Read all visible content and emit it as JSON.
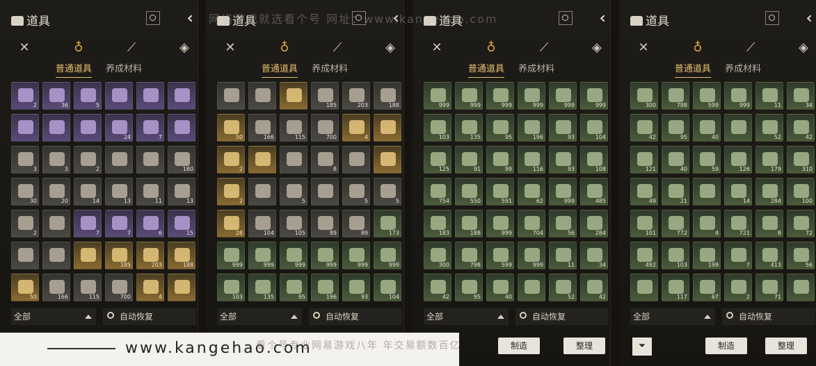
{
  "panel_title": "道具",
  "sub_tabs": [
    "普通道具",
    "养成材料"
  ],
  "filter_label": "全部",
  "auto_restore": "自动恢复",
  "craft_button": "制造",
  "sort_button": "整理",
  "banner_url": "www.kangehao.com",
  "watermark_top": "网络游戏就选看个号  网址：www.kangehao.com",
  "watermark_bottom": "看个号专业网易游戏八年  年交易额数百亿",
  "icons": {
    "category_1": "crossed-swords-icon",
    "category_2": "pouch-icon",
    "category_3": "scroll-icon",
    "category_4": "gem-icon"
  },
  "colors": {
    "accent": "#e8c070",
    "panel": "#1e1c18"
  },
  "panels": [
    {
      "rows": [
        [
          {
            "r": "purple",
            "c": "2"
          },
          {
            "r": "purple",
            "c": "36"
          },
          {
            "r": "purple",
            "c": "5"
          },
          {
            "r": "purple",
            "c": ""
          },
          {
            "r": "purple",
            "c": ""
          },
          {
            "r": "purple",
            "c": ""
          }
        ],
        [
          {
            "r": "purple",
            "c": ""
          },
          {
            "r": "purple",
            "c": ""
          },
          {
            "r": "purple",
            "c": ""
          },
          {
            "r": "purple",
            "c": "24"
          },
          {
            "r": "purple",
            "c": "7"
          },
          {
            "r": "purple",
            "c": ""
          }
        ],
        [
          {
            "r": "gray",
            "c": "3"
          },
          {
            "r": "gray",
            "c": "3"
          },
          {
            "r": "gray",
            "c": "2"
          },
          {
            "r": "gray",
            "c": ""
          },
          {
            "r": "gray",
            "c": ""
          },
          {
            "r": "gray",
            "c": "180"
          }
        ],
        [
          {
            "r": "gray",
            "c": "30"
          },
          {
            "r": "gray",
            "c": "20"
          },
          {
            "r": "gray",
            "c": "14"
          },
          {
            "r": "gray",
            "c": "13"
          },
          {
            "r": "gray",
            "c": "11"
          },
          {
            "r": "gray",
            "c": "13"
          }
        ],
        [
          {
            "r": "gray",
            "c": "2"
          },
          {
            "r": "gray",
            "c": ""
          },
          {
            "r": "purple",
            "c": "7"
          },
          {
            "r": "purple",
            "c": "7"
          },
          {
            "r": "purple",
            "c": "6"
          },
          {
            "r": "purple",
            "c": "15"
          }
        ],
        [
          {
            "r": "gray",
            "c": ""
          },
          {
            "r": "gray",
            "c": ""
          },
          {
            "r": "gold",
            "c": ""
          },
          {
            "r": "gold",
            "c": "185"
          },
          {
            "r": "gold",
            "c": "203"
          },
          {
            "r": "gold",
            "c": "188"
          }
        ],
        [
          {
            "r": "gold",
            "c": "50"
          },
          {
            "r": "gray",
            "c": "166"
          },
          {
            "r": "gray",
            "c": "115"
          },
          {
            "r": "gray",
            "c": "700"
          },
          {
            "r": "gold",
            "c": "4"
          },
          {
            "r": "gold",
            "c": ""
          }
        ]
      ]
    },
    {
      "rows": [
        [
          {
            "r": "gray",
            "c": ""
          },
          {
            "r": "gray",
            "c": ""
          },
          {
            "r": "gold",
            "c": ""
          },
          {
            "r": "gray",
            "c": "185"
          },
          {
            "r": "gray",
            "c": "203"
          },
          {
            "r": "gray",
            "c": "188"
          }
        ],
        [
          {
            "r": "gold",
            "c": "50"
          },
          {
            "r": "gray",
            "c": "166"
          },
          {
            "r": "gray",
            "c": "115"
          },
          {
            "r": "gray",
            "c": "700"
          },
          {
            "r": "gold",
            "c": "4"
          },
          {
            "r": "gold",
            "c": ""
          }
        ],
        [
          {
            "r": "gold",
            "c": "2"
          },
          {
            "r": "gold",
            "c": ""
          },
          {
            "r": "gray",
            "c": ""
          },
          {
            "r": "gray",
            "c": "8"
          },
          {
            "r": "gray",
            "c": ""
          },
          {
            "r": "gold",
            "c": ""
          }
        ],
        [
          {
            "r": "gold",
            "c": "2"
          },
          {
            "r": "gray",
            "c": ""
          },
          {
            "r": "gray",
            "c": "5"
          },
          {
            "r": "gray",
            "c": ""
          },
          {
            "r": "gray",
            "c": "5"
          },
          {
            "r": "gray",
            "c": "5"
          }
        ],
        [
          {
            "r": "gold",
            "c": "28"
          },
          {
            "r": "gray",
            "c": "104"
          },
          {
            "r": "gray",
            "c": "105"
          },
          {
            "r": "gray",
            "c": "89"
          },
          {
            "r": "gray",
            "c": "89"
          },
          {
            "r": "green",
            "c": "173"
          }
        ],
        [
          {
            "r": "green",
            "c": "999"
          },
          {
            "r": "green",
            "c": "999"
          },
          {
            "r": "green",
            "c": "999"
          },
          {
            "r": "green",
            "c": "999"
          },
          {
            "r": "green",
            "c": "999"
          },
          {
            "r": "green",
            "c": "999"
          }
        ],
        [
          {
            "r": "green",
            "c": "103"
          },
          {
            "r": "green",
            "c": "135"
          },
          {
            "r": "green",
            "c": "95"
          },
          {
            "r": "green",
            "c": "196"
          },
          {
            "r": "green",
            "c": "93"
          },
          {
            "r": "green",
            "c": "104"
          }
        ]
      ]
    },
    {
      "rows": [
        [
          {
            "r": "green",
            "c": "999"
          },
          {
            "r": "green",
            "c": "999"
          },
          {
            "r": "green",
            "c": "999"
          },
          {
            "r": "green",
            "c": "999"
          },
          {
            "r": "green",
            "c": "999"
          },
          {
            "r": "green",
            "c": "999"
          }
        ],
        [
          {
            "r": "green",
            "c": "103"
          },
          {
            "r": "green",
            "c": "135"
          },
          {
            "r": "green",
            "c": "95"
          },
          {
            "r": "green",
            "c": "196"
          },
          {
            "r": "green",
            "c": "93"
          },
          {
            "r": "green",
            "c": "104"
          }
        ],
        [
          {
            "r": "green",
            "c": "125"
          },
          {
            "r": "green",
            "c": "91"
          },
          {
            "r": "green",
            "c": "99"
          },
          {
            "r": "green",
            "c": "116"
          },
          {
            "r": "green",
            "c": "93"
          },
          {
            "r": "green",
            "c": "108"
          }
        ],
        [
          {
            "r": "green",
            "c": "754"
          },
          {
            "r": "green",
            "c": "550"
          },
          {
            "r": "green",
            "c": "591"
          },
          {
            "r": "green",
            "c": "62"
          },
          {
            "r": "green",
            "c": "999"
          },
          {
            "r": "green",
            "c": "485"
          }
        ],
        [
          {
            "r": "green",
            "c": "183"
          },
          {
            "r": "green",
            "c": "188"
          },
          {
            "r": "green",
            "c": "999"
          },
          {
            "r": "green",
            "c": "704"
          },
          {
            "r": "green",
            "c": "56"
          },
          {
            "r": "green",
            "c": "284"
          }
        ],
        [
          {
            "r": "green",
            "c": "300"
          },
          {
            "r": "green",
            "c": "798"
          },
          {
            "r": "green",
            "c": "599"
          },
          {
            "r": "green",
            "c": "999"
          },
          {
            "r": "green",
            "c": "11"
          },
          {
            "r": "green",
            "c": "34"
          }
        ],
        [
          {
            "r": "green",
            "c": "42"
          },
          {
            "r": "green",
            "c": "95"
          },
          {
            "r": "green",
            "c": "40"
          },
          {
            "r": "green",
            "c": ""
          },
          {
            "r": "green",
            "c": "52"
          },
          {
            "r": "green",
            "c": "42"
          }
        ]
      ]
    },
    {
      "rows": [
        [
          {
            "r": "green",
            "c": "300"
          },
          {
            "r": "green",
            "c": "798"
          },
          {
            "r": "green",
            "c": "599"
          },
          {
            "r": "green",
            "c": "999"
          },
          {
            "r": "green",
            "c": "11"
          },
          {
            "r": "green",
            "c": "34"
          }
        ],
        [
          {
            "r": "green",
            "c": "42"
          },
          {
            "r": "green",
            "c": "95"
          },
          {
            "r": "green",
            "c": "40"
          },
          {
            "r": "green",
            "c": ""
          },
          {
            "r": "green",
            "c": "52"
          },
          {
            "r": "green",
            "c": "42"
          }
        ],
        [
          {
            "r": "green",
            "c": "121"
          },
          {
            "r": "green",
            "c": "40"
          },
          {
            "r": "green",
            "c": "59"
          },
          {
            "r": "green",
            "c": "126"
          },
          {
            "r": "green",
            "c": "179"
          },
          {
            "r": "green",
            "c": "310"
          }
        ],
        [
          {
            "r": "green",
            "c": "49"
          },
          {
            "r": "green",
            "c": "21"
          },
          {
            "r": "green",
            "c": ""
          },
          {
            "r": "green",
            "c": "14"
          },
          {
            "r": "green",
            "c": "284"
          },
          {
            "r": "green",
            "c": "100"
          }
        ],
        [
          {
            "r": "green",
            "c": "101"
          },
          {
            "r": "green",
            "c": "772"
          },
          {
            "r": "green",
            "c": "4"
          },
          {
            "r": "green",
            "c": "721"
          },
          {
            "r": "green",
            "c": "8"
          },
          {
            "r": "green",
            "c": "72"
          }
        ],
        [
          {
            "r": "green",
            "c": "492"
          },
          {
            "r": "green",
            "c": "103"
          },
          {
            "r": "green",
            "c": "199"
          },
          {
            "r": "green",
            "c": "7"
          },
          {
            "r": "green",
            "c": "413"
          },
          {
            "r": "green",
            "c": "56"
          }
        ],
        [
          {
            "r": "green",
            "c": ""
          },
          {
            "r": "green",
            "c": "117"
          },
          {
            "r": "green",
            "c": "67"
          },
          {
            "r": "green",
            "c": "2"
          },
          {
            "r": "green",
            "c": "71"
          },
          {
            "r": "green",
            "c": ""
          }
        ]
      ]
    }
  ]
}
